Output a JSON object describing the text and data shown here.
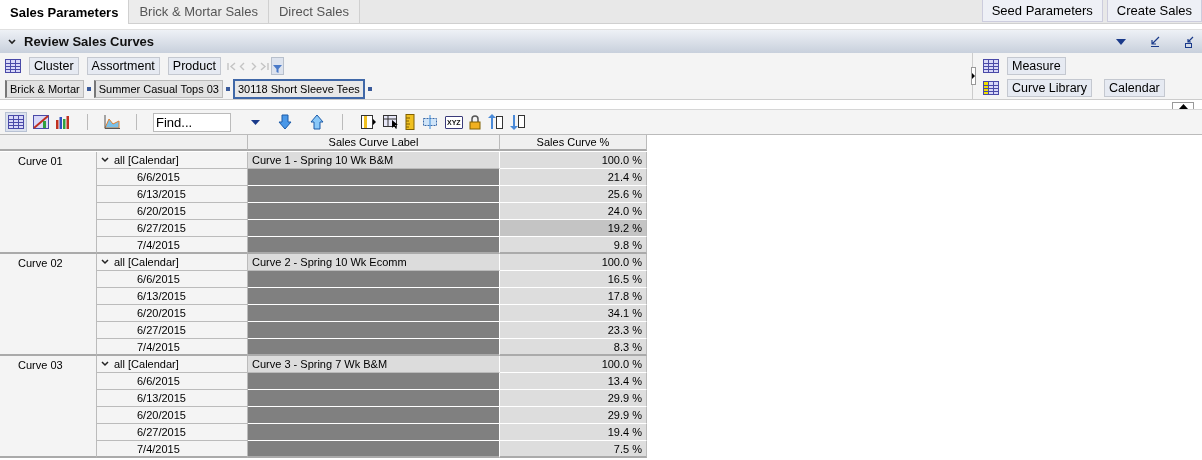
{
  "tabs": [
    {
      "label": "Sales Parameters",
      "selected": true
    },
    {
      "label": "Brick & Mortar Sales",
      "selected": false
    },
    {
      "label": "Direct Sales",
      "selected": false
    }
  ],
  "actions": [
    "Seed Parameters",
    "Create Sales"
  ],
  "section": {
    "title": "Review Sales Curves",
    "expanded": true
  },
  "pivot": {
    "row_dims": [
      "Cluster",
      "Assortment",
      "Product"
    ],
    "breadcrumb": [
      {
        "label": "Brick & Mortar",
        "selected": false
      },
      {
        "label": "Summer Casual Tops 03",
        "selected": false
      },
      {
        "label": "30118 Short Sleeve Tees",
        "selected": true
      }
    ],
    "measure_dims": [
      "Measure"
    ],
    "column_dims": [
      "Curve Library",
      "Calendar"
    ]
  },
  "toolbar": {
    "find_placeholder": "Find...",
    "xyz_label": "XYZ"
  },
  "grid": {
    "columns": [
      "Sales Curve Label",
      "Sales Curve %"
    ],
    "curves": [
      {
        "label": "Curve 01",
        "calendar": "all [Calendar]",
        "expanded": true,
        "curve_label": "Curve 1 - Spring 10 Wk B&M",
        "total": "100.0 %",
        "weeks": [
          {
            "date": "6/6/2015",
            "value": "21.4 %",
            "selected": false
          },
          {
            "date": "6/13/2015",
            "value": "25.6 %",
            "selected": false
          },
          {
            "date": "6/20/2015",
            "value": "24.0 %",
            "selected": false
          },
          {
            "date": "6/27/2015",
            "value": "19.2 %",
            "selected": true
          },
          {
            "date": "7/4/2015",
            "value": "9.8 %",
            "selected": false
          }
        ]
      },
      {
        "label": "Curve 02",
        "calendar": "all [Calendar]",
        "expanded": true,
        "curve_label": "Curve 2 - Spring 10 Wk Ecomm",
        "total": "100.0 %",
        "weeks": [
          {
            "date": "6/6/2015",
            "value": "16.5 %",
            "selected": false
          },
          {
            "date": "6/13/2015",
            "value": "17.8 %",
            "selected": false
          },
          {
            "date": "6/20/2015",
            "value": "34.1 %",
            "selected": false
          },
          {
            "date": "6/27/2015",
            "value": "23.3 %",
            "selected": false
          },
          {
            "date": "7/4/2015",
            "value": "8.3 %",
            "selected": false
          }
        ]
      },
      {
        "label": "Curve 03",
        "calendar": "all [Calendar]",
        "expanded": true,
        "curve_label": "Curve 3 - Spring 7 Wk B&M",
        "total": "100.0 %",
        "weeks": [
          {
            "date": "6/6/2015",
            "value": "13.4 %",
            "selected": false
          },
          {
            "date": "6/13/2015",
            "value": "29.9 %",
            "selected": false
          },
          {
            "date": "6/20/2015",
            "value": "29.9 %",
            "selected": false
          },
          {
            "date": "6/27/2015",
            "value": "19.4 %",
            "selected": false
          },
          {
            "date": "7/4/2015",
            "value": "7.5 %",
            "selected": false
          }
        ]
      }
    ]
  }
}
